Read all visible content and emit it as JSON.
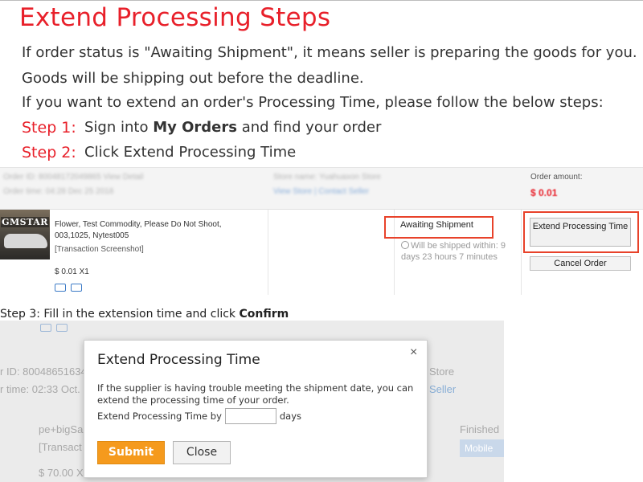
{
  "heading": {
    "title": "Extend Processing Steps",
    "line1": "If order status is \"Awaiting Shipment\", it means seller is preparing the goods for you.",
    "line2": "Goods will be shipping out before the deadline.",
    "line3": "If you want to extend an order's Processing Time, please follow the below steps:"
  },
  "steps": {
    "step1_label": "Step 1:",
    "step1_pre": "Sign into ",
    "step1_bold": "My Orders",
    "step1_post": " and find your order",
    "step2_label": "Step 2:",
    "step2_text": "Click Extend Processing Time",
    "step3_pre": "Step 3: Fill in the extension time and click ",
    "step3_bold": "Confirm"
  },
  "order": {
    "blurred_order_id": "Order ID: 80048172049865 View Detail",
    "blurred_order_time": "Order time: 04:28 Dec 25 2018",
    "blurred_store_name": "Store name: Yuahuaxon Store",
    "blurred_store_links": "View Store  |  Contact Seller",
    "amount_label": "Order amount:",
    "amount_value": "$ 0.01",
    "thumb_logo": "GMSTAR",
    "product_title": "Flower, Test Commodity, Please Do Not Shoot, 003,1025, Nytest005",
    "product_sub": "[Transaction Screenshot]",
    "product_price": "$ 0.01 X1",
    "status": "Awaiting Shipment",
    "ship_note": "Will be shipped within: 9 days 23 hours 7 minutes",
    "extend_button": "Extend Processing Time",
    "cancel_button": "Cancel Order"
  },
  "background_screen": {
    "order_id_fragment": "r ID: 80048651634",
    "order_time_fragment": "r time: 02:33 Oct.",
    "store_fragment": "Store",
    "seller_fragment": "Seller",
    "product_fragment": "pe+bigSa",
    "transaction_fragment": "[Transact",
    "price_fragment": "$ 70.00 X",
    "finished_fragment": "Finished",
    "mobile_fragment": "Mobile"
  },
  "modal": {
    "title": "Extend Processing Time",
    "close_symbol": "×",
    "description": "If the supplier is having trouble meeting the shipment date, you can extend the processing time of your order.",
    "field_label": "Extend Processing Time by",
    "field_value": "",
    "field_unit": "days",
    "submit_button": "Submit",
    "close_button": "Close"
  },
  "colors": {
    "accent_red": "#e8202a",
    "highlight_box": "#e8422a",
    "submit_orange": "#f59a1d",
    "link_blue": "#3d7bc7"
  }
}
